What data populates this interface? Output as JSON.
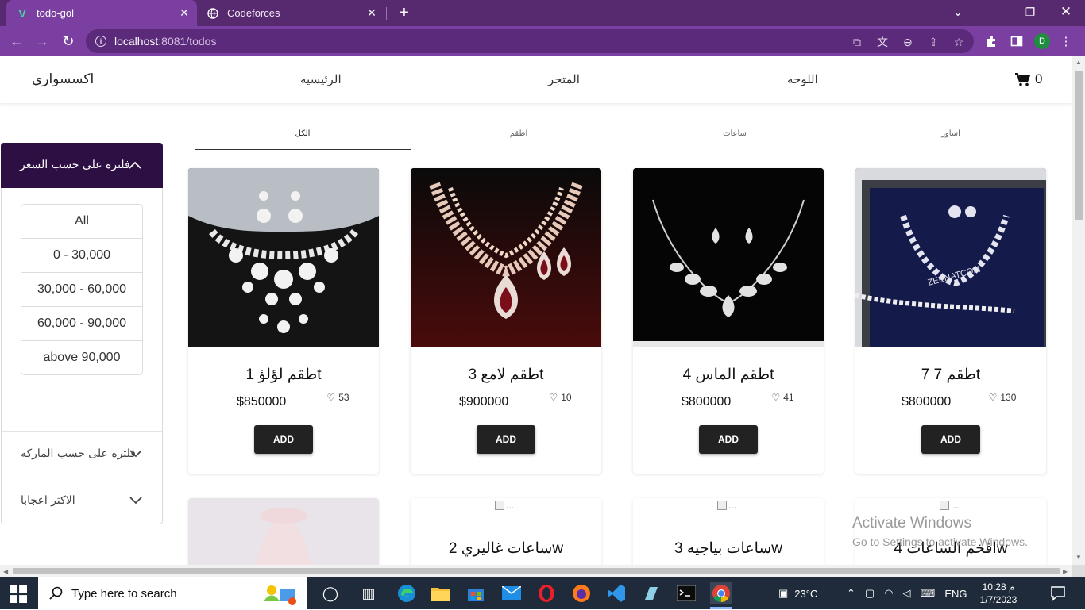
{
  "browser": {
    "tabs": [
      {
        "title": "todo-gol",
        "favicon": "vue-icon",
        "active": true
      },
      {
        "title": "Codeforces",
        "favicon": "globe-icon",
        "active": false
      }
    ],
    "url_host": "localhost",
    "url_rest": ":8081/todos",
    "profile_initial": "D",
    "accent_color": "#7b3fa1",
    "tabbar_color": "#57296f"
  },
  "site": {
    "brand": "اكسسواري",
    "nav": [
      "الرئيسيه",
      "المتجر",
      "اللوحه"
    ],
    "cart_count": "0"
  },
  "categories": [
    "الكل",
    "اطقم",
    "ساعات",
    "اساور"
  ],
  "selected_category": "الكل",
  "sidebar": {
    "price_filter_title": "فلتره على حسب السعر",
    "price_options": [
      "All",
      "0 - 30,000",
      "30,000 - 60,000",
      "60,000 - 90,000",
      "above 90,000"
    ],
    "brand_filter_title": "فلتره على حسب الماركه",
    "popular_title": "الاكثر اعجابا"
  },
  "products": [
    {
      "name": "طقم لؤلؤ 1t",
      "price": "$850000",
      "likes": "53",
      "add_label": "ADD",
      "image": "necklace-set-icon"
    },
    {
      "name": "طقم لامع 3t",
      "price": "$900000",
      "likes": "10",
      "add_label": "ADD",
      "image": "necklace-set-icon"
    },
    {
      "name": "طقم الماس 4t",
      "price": "$800000",
      "likes": "41",
      "add_label": "ADD",
      "image": "necklace-set-icon"
    },
    {
      "name": "طقم 7 7t",
      "price": "$800000",
      "likes": "130",
      "add_label": "ADD",
      "image": "necklace-set-icon"
    }
  ],
  "products_row2": [
    {
      "name": "",
      "alt": ""
    },
    {
      "name": "ساعات غاليري 2w",
      "alt": "..."
    },
    {
      "name": "ساعات بياجيه 3w",
      "alt": "..."
    },
    {
      "name": "افخم الساعات 4w",
      "alt": "..."
    }
  ],
  "watermark": {
    "line1": "Activate Windows",
    "line2": "Go to Settings to activate Windows."
  },
  "taskbar": {
    "search_placeholder": "Type here to search",
    "temperature": "23°C",
    "language": "ENG",
    "time": "10:28 م",
    "date": "1/7/2023"
  }
}
